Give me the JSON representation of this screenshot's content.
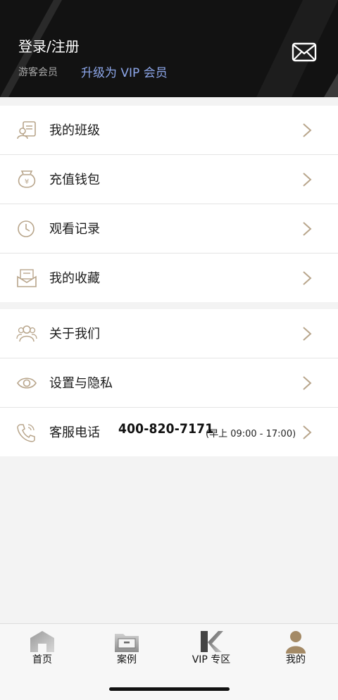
{
  "header": {
    "title": "登录/注册",
    "guest_label": "游客会员",
    "vip_link": "升级为 VIP 会员"
  },
  "menu_group_1": [
    {
      "label": "我的班级",
      "icon": "class-card-icon"
    },
    {
      "label": "充值钱包",
      "icon": "money-bag-icon"
    },
    {
      "label": "观看记录",
      "icon": "clock-icon"
    },
    {
      "label": "我的收藏",
      "icon": "envelope-open-icon"
    }
  ],
  "menu_group_2": [
    {
      "label": "关于我们",
      "icon": "users-icon"
    },
    {
      "label": "设置与隐私",
      "icon": "eye-icon"
    },
    {
      "label": "客服电话",
      "icon": "phone-icon",
      "phone": "400-820-7171",
      "hours": "(早上 09:00 - 17:00)"
    }
  ],
  "tabbar": [
    {
      "label": "首页",
      "icon": "home-icon"
    },
    {
      "label": "案例",
      "icon": "folder-icon"
    },
    {
      "label": "VIP 专区",
      "icon": "vip-k-logo-icon"
    },
    {
      "label": "我的",
      "icon": "profile-icon",
      "active": true
    }
  ],
  "colors": {
    "header_bg": "#121212",
    "vip_link": "#8da7ea",
    "icon_tint": "#b8a58b",
    "chevron": "#b8a58b"
  }
}
